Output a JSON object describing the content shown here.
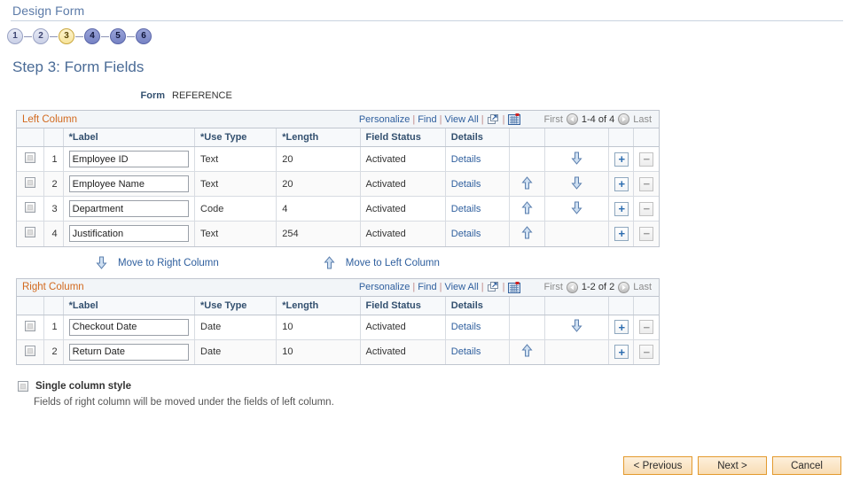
{
  "page": {
    "title": "Design Form",
    "heading": "Step 3: Form Fields"
  },
  "steps": [
    {
      "number": "1",
      "state": "done"
    },
    {
      "number": "2",
      "state": "done"
    },
    {
      "number": "3",
      "state": "current"
    },
    {
      "number": "4",
      "state": "future"
    },
    {
      "number": "5",
      "state": "future"
    },
    {
      "number": "6",
      "state": "future"
    }
  ],
  "form": {
    "label": "Form",
    "value": "REFERENCE"
  },
  "toolbar": {
    "personalize": "Personalize",
    "find": "Find",
    "view_all": "View All",
    "sep": "|",
    "first": "First",
    "last": "Last",
    "expand_icon": "expand-window-icon",
    "grid_icon": "download-grid-icon"
  },
  "columns": {
    "label": "*Label",
    "use_type": "*Use Type",
    "length": "*Length",
    "field_status": "Field Status",
    "details": "Details"
  },
  "left_grid": {
    "caption": "Left Column",
    "count": "1-4 of 4",
    "rows": [
      {
        "num": "1",
        "label": "Employee ID",
        "use_type": "Text",
        "length": "20",
        "status": "Activated",
        "details": "Details",
        "up": false,
        "down": true
      },
      {
        "num": "2",
        "label": "Employee Name",
        "use_type": "Text",
        "length": "20",
        "status": "Activated",
        "details": "Details",
        "up": true,
        "down": true
      },
      {
        "num": "3",
        "label": "Department",
        "use_type": "Code",
        "length": "4",
        "status": "Activated",
        "details": "Details",
        "up": true,
        "down": true
      },
      {
        "num": "4",
        "label": "Justification",
        "use_type": "Text",
        "length": "254",
        "status": "Activated",
        "details": "Details",
        "up": true,
        "down": false
      }
    ]
  },
  "right_grid": {
    "caption": "Right Column",
    "count": "1-2 of 2",
    "rows": [
      {
        "num": "1",
        "label": "Checkout Date",
        "use_type": "Date",
        "length": "10",
        "status": "Activated",
        "details": "Details",
        "up": false,
        "down": true
      },
      {
        "num": "2",
        "label": "Return Date",
        "use_type": "Date",
        "length": "10",
        "status": "Activated",
        "details": "Details",
        "up": true,
        "down": false
      }
    ]
  },
  "move": {
    "to_right": "Move to Right Column",
    "to_left": "Move to Left Column"
  },
  "single_column": {
    "label": "Single column style",
    "note": "Fields of right column will be moved under the fields of left column.",
    "checked": false
  },
  "footer": {
    "previous": "< Previous",
    "next": "Next >",
    "cancel": "Cancel"
  },
  "colors": {
    "title_blue": "#5c7ba8",
    "heading_blue": "#4a6b96",
    "caption_orange": "#d2691e",
    "link_blue": "#2f5f9e",
    "current_step": "#f7e49a",
    "button_tan": "#f8ddb4"
  }
}
